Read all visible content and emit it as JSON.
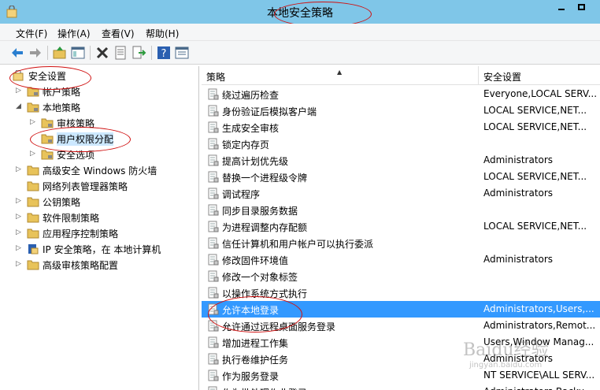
{
  "window": {
    "title": "本地安全策略"
  },
  "menu": [
    {
      "label": "文件(F)"
    },
    {
      "label": "操作(A)"
    },
    {
      "label": "查看(V)"
    },
    {
      "label": "帮助(H)"
    }
  ],
  "toolbar": [
    {
      "icon": "back-arrow-icon"
    },
    {
      "icon": "forward-arrow-icon"
    },
    {
      "icon": "up-folder-icon"
    },
    {
      "icon": "show-hide-console-tree-icon"
    },
    {
      "icon": "delete-x-icon"
    },
    {
      "icon": "properties-icon"
    },
    {
      "icon": "export-list-icon"
    },
    {
      "icon": "help-icon"
    },
    {
      "icon": "view-icon"
    }
  ],
  "tree": [
    {
      "label": "安全设置",
      "level": 0,
      "expander": "none"
    },
    {
      "label": "帐户策略",
      "level": 1,
      "expander": "collapsed"
    },
    {
      "label": "本地策略",
      "level": 1,
      "expander": "expanded"
    },
    {
      "label": "审核策略",
      "level": 2,
      "expander": "collapsed"
    },
    {
      "label": "用户权限分配",
      "level": 2,
      "expander": "none"
    },
    {
      "label": "安全选项",
      "level": 2,
      "expander": "collapsed"
    },
    {
      "label": "高级安全 Windows 防火墙",
      "level": 1,
      "expander": "collapsed"
    },
    {
      "label": "网络列表管理器策略",
      "level": 1,
      "expander": "none"
    },
    {
      "label": "公钥策略",
      "level": 1,
      "expander": "collapsed"
    },
    {
      "label": "软件限制策略",
      "level": 1,
      "expander": "collapsed"
    },
    {
      "label": "应用程序控制策略",
      "level": 1,
      "expander": "collapsed"
    },
    {
      "label": "IP 安全策略，在 本地计算机",
      "level": 1,
      "expander": "collapsed"
    },
    {
      "label": "高级审核策略配置",
      "level": 1,
      "expander": "collapsed"
    }
  ],
  "list": {
    "headers": {
      "policy": "策略",
      "setting": "安全设置"
    },
    "rows": [
      {
        "policy": "绕过遍历检查",
        "setting": "Everyone,LOCAL SERV..."
      },
      {
        "policy": "身份验证后模拟客户端",
        "setting": "LOCAL SERVICE,NET..."
      },
      {
        "policy": "生成安全审核",
        "setting": "LOCAL SERVICE,NET..."
      },
      {
        "policy": "锁定内存页",
        "setting": ""
      },
      {
        "policy": "提高计划优先级",
        "setting": "Administrators"
      },
      {
        "policy": "替换一个进程级令牌",
        "setting": "LOCAL SERVICE,NET..."
      },
      {
        "policy": "调试程序",
        "setting": "Administrators"
      },
      {
        "policy": "同步目录服务数据",
        "setting": ""
      },
      {
        "policy": "为进程调整内存配额",
        "setting": "LOCAL SERVICE,NET..."
      },
      {
        "policy": "信任计算机和用户帐户可以执行委派",
        "setting": ""
      },
      {
        "policy": "修改固件环境值",
        "setting": "Administrators"
      },
      {
        "policy": "修改一个对象标签",
        "setting": ""
      },
      {
        "policy": "以操作系统方式执行",
        "setting": ""
      },
      {
        "policy": "允许本地登录",
        "setting": "Administrators,Users,..."
      },
      {
        "policy": "允许通过远程桌面服务登录",
        "setting": "Administrators,Remot..."
      },
      {
        "policy": "增加进程工作集",
        "setting": "Users,Window Manag..."
      },
      {
        "policy": "执行卷维护任务",
        "setting": "Administrators"
      },
      {
        "policy": "作为服务登录",
        "setting": "NT SERVICE\\ALL SERV..."
      },
      {
        "policy": "作为批处理作业登录",
        "setting": "Administrators,Backu..."
      }
    ]
  },
  "watermark": {
    "text": "Baidu经验",
    "sub": "jingyan.baidu.com"
  },
  "colors": {
    "titlebar": "#7fc6e8",
    "selection": "#3399ff",
    "annotation": "#d01010"
  }
}
